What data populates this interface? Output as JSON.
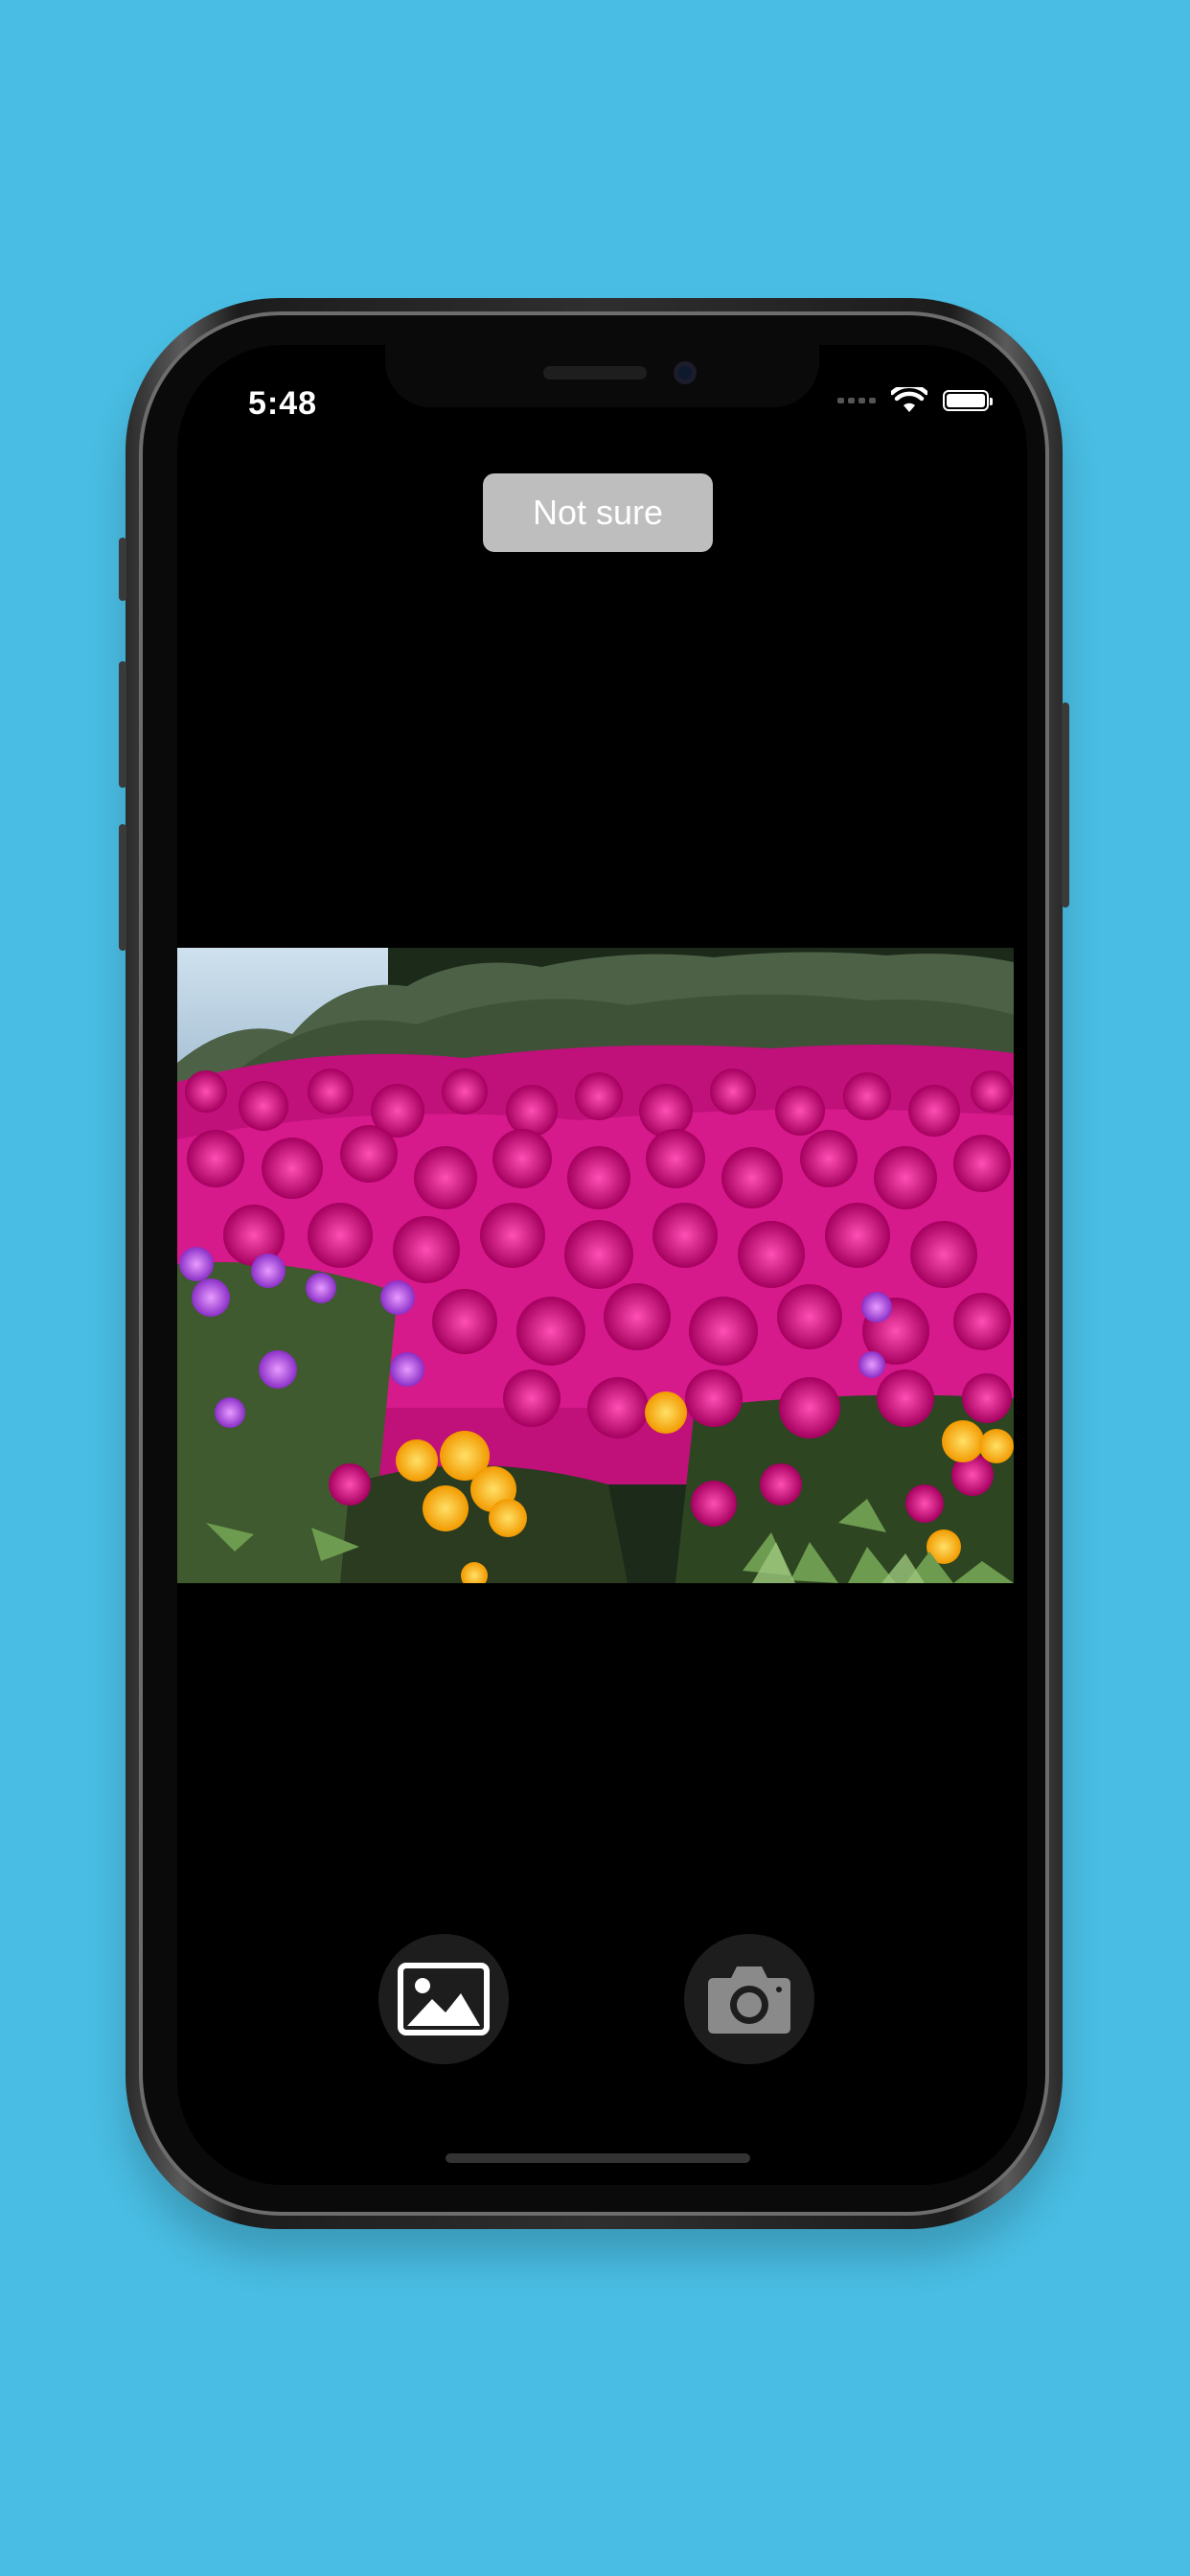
{
  "status_bar": {
    "time": "5:48",
    "icons": [
      "cellular-signal-icon",
      "wifi-icon",
      "battery-icon"
    ]
  },
  "result": {
    "label": "Not sure"
  },
  "photo": {
    "subject": "magenta-flower-field-image"
  },
  "actions": {
    "gallery_icon": "photo-library-icon",
    "camera_icon": "camera-icon"
  },
  "colors": {
    "background": "#49BDE3",
    "screen": "#000000",
    "result_button": "#BEBEBE",
    "action_button": "#1D1D1D"
  }
}
